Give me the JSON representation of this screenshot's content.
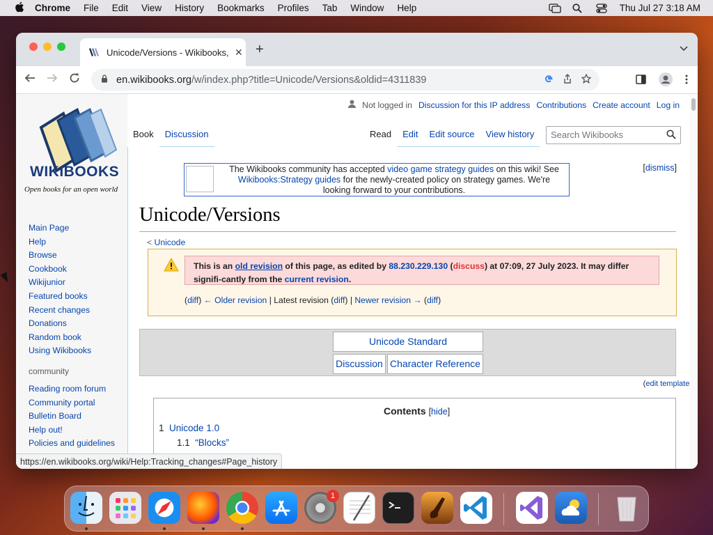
{
  "menubar": {
    "app": "Chrome",
    "items": [
      "File",
      "Edit",
      "View",
      "History",
      "Bookmarks",
      "Profiles",
      "Tab",
      "Window",
      "Help"
    ],
    "clock": "Thu Jul 27  3:18 AM"
  },
  "browser": {
    "tab_title": "Unicode/Versions - Wikibooks,",
    "url_host": "en.wikibooks.org",
    "url_path": "/w/index.php?title=Unicode/Versions&oldid=4311839",
    "status_url": "https://en.wikibooks.org/wiki/Help:Tracking_changes#Page_history"
  },
  "wiki": {
    "logo_title": "WIKIBOOKS",
    "logo_subtitle": "Open books for an open world",
    "user_links": {
      "not_logged": "Not logged in",
      "discussion_ip": "Discussion for this IP address",
      "contributions": "Contributions",
      "create_account": "Create account",
      "log_in": "Log in"
    },
    "tabs_left": [
      "Book",
      "Discussion"
    ],
    "tabs_right": [
      "Read",
      "Edit",
      "Edit source",
      "View history"
    ],
    "search_placeholder": "Search Wikibooks",
    "sidebar_nav": [
      "Main Page",
      "Help",
      "Browse",
      "Cookbook",
      "Wikijunior",
      "Featured books",
      "Recent changes",
      "Donations",
      "Random book",
      "Using Wikibooks"
    ],
    "community_heading": "community",
    "community_links": [
      "Reading room forum",
      "Community portal",
      "Bulletin Board",
      "Help out!",
      "Policies and guidelines"
    ],
    "sitenotice": {
      "t1": "The Wikibooks community has accepted ",
      "l1": "video game strategy guides",
      "t2": " on this wiki! See ",
      "l2": "Wikibooks:Strategy guides",
      "t3": " for the newly-created policy on strategy games. We're looking forward to your contributions.",
      "dismiss": "dismiss"
    },
    "heading": "Unicode/Versions",
    "subpage_prefix": "< ",
    "subpage_link": "Unicode",
    "revision": {
      "t1": "This is an ",
      "old_revision": "old revision",
      "t2": " of this page, as edited by ",
      "ip": "88.230.229.130",
      "discuss": "discuss",
      "t3": " at 07:09, 27 July 2023. It may differ signifi-cantly from the ",
      "current": "current revision",
      "t4": ".",
      "diff1": "diff",
      "older": "← Older revision",
      "latest": "Latest revision",
      "diff2": "diff",
      "newer": "Newer revision →",
      "diff3": "diff"
    },
    "navbox": {
      "standard": "Unicode Standard",
      "discussion": "Discussion",
      "charref": "Character Reference",
      "edit_template": "edit template"
    },
    "toc": {
      "title": "Contents",
      "hide": "hide",
      "items": [
        {
          "num": "1",
          "label": "Unicode 1.0"
        },
        {
          "num": "1.1",
          "label": "“Blocks”"
        }
      ]
    }
  },
  "dock": {
    "items": [
      "Finder",
      "Launchpad",
      "Safari",
      "Firefox",
      "Chrome",
      "App Store",
      "System Settings",
      "TextEdit",
      "Terminal",
      "Instruments",
      "Visual Studio Code",
      "Visual Studio",
      "Weather",
      "Trash"
    ],
    "settings_badge": "1"
  }
}
